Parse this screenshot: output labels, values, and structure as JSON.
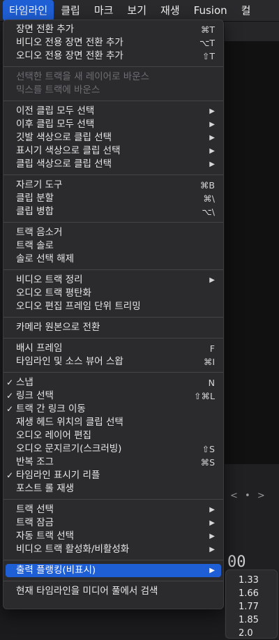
{
  "menubar": {
    "items": [
      "타임라인",
      "클립",
      "마크",
      "보기",
      "재생",
      "Fusion",
      "컬"
    ]
  },
  "background": {
    "transport": "< • >",
    "timecode": "00"
  },
  "menu": {
    "groups": [
      [
        {
          "label": "장면 전환 추가",
          "shortcut": "⌘T"
        },
        {
          "label": "비디오 전용 장면 전환 추가",
          "shortcut": "⌥T"
        },
        {
          "label": "오디오 전용 장면 전환 추가",
          "shortcut": "⇧T"
        }
      ],
      [
        {
          "label": "선택한 트랙을 새 레이어로 바운스",
          "disabled": true
        },
        {
          "label": "믹스를 트랙에 바운스",
          "disabled": true
        }
      ],
      [
        {
          "label": "이전 클립 모두 선택",
          "submenu": true
        },
        {
          "label": "이후 클립 모두 선택",
          "submenu": true
        },
        {
          "label": "깃발 색상으로 클립 선택",
          "submenu": true
        },
        {
          "label": "표시기 색상으로 클립 선택",
          "submenu": true
        },
        {
          "label": "클립 색상으로 클립 선택",
          "submenu": true
        }
      ],
      [
        {
          "label": "자르기 도구",
          "shortcut": "⌘B"
        },
        {
          "label": "클립 분할",
          "shortcut": "⌘\\"
        },
        {
          "label": "클립 병합",
          "shortcut": "⌥\\"
        }
      ],
      [
        {
          "label": "트랙 음소거"
        },
        {
          "label": "트랙 솔로"
        },
        {
          "label": "솔로 선택 해제"
        }
      ],
      [
        {
          "label": "비디오 트랙 정리",
          "submenu": true
        },
        {
          "label": "오디오 트랙 평탄화"
        },
        {
          "label": "오디오 편집 프레임 단위 트리밍"
        }
      ],
      [
        {
          "label": "카메라 원본으로 전환"
        }
      ],
      [
        {
          "label": "배시 프레임",
          "shortcut": "F"
        },
        {
          "label": "타임라인 및 소스 뷰어 스왑",
          "shortcut": "⌘I"
        }
      ],
      [
        {
          "label": "스냅",
          "shortcut": "N",
          "checked": true
        },
        {
          "label": "링크 선택",
          "shortcut": "⇧⌘L",
          "checked": true
        },
        {
          "label": "트랙 간 링크 이동",
          "checked": true
        },
        {
          "label": "재생 헤드 위치의 클립 선택"
        },
        {
          "label": "오디오 레이어 편집"
        },
        {
          "label": "오디오 문지르기(스크러빙)",
          "shortcut": "⇧S"
        },
        {
          "label": "반복 조그",
          "shortcut": "⌘S"
        },
        {
          "label": "타임라인 표시기 리플",
          "checked": true
        },
        {
          "label": "포스트 롤 재생"
        }
      ],
      [
        {
          "label": "트랙 선택",
          "submenu": true
        },
        {
          "label": "트랙 잠금",
          "submenu": true
        },
        {
          "label": "자동 트랙 선택",
          "submenu": true
        },
        {
          "label": "비디오 트랙 활성화/비활성화",
          "submenu": true
        }
      ],
      [
        {
          "label": "출력 플랭킹(비표시)",
          "submenu": true,
          "highlight": true
        }
      ],
      [
        {
          "label": "현재 타임라인을 미디어 풀에서 검색"
        }
      ]
    ]
  },
  "submenu": {
    "items": [
      "1.33",
      "1.66",
      "1.77",
      "1.85",
      "2.0"
    ]
  },
  "colors": {
    "accent": "#1f5fd6",
    "menu_bg": "#2b2b2d",
    "disabled_text": "#6f6f74"
  }
}
